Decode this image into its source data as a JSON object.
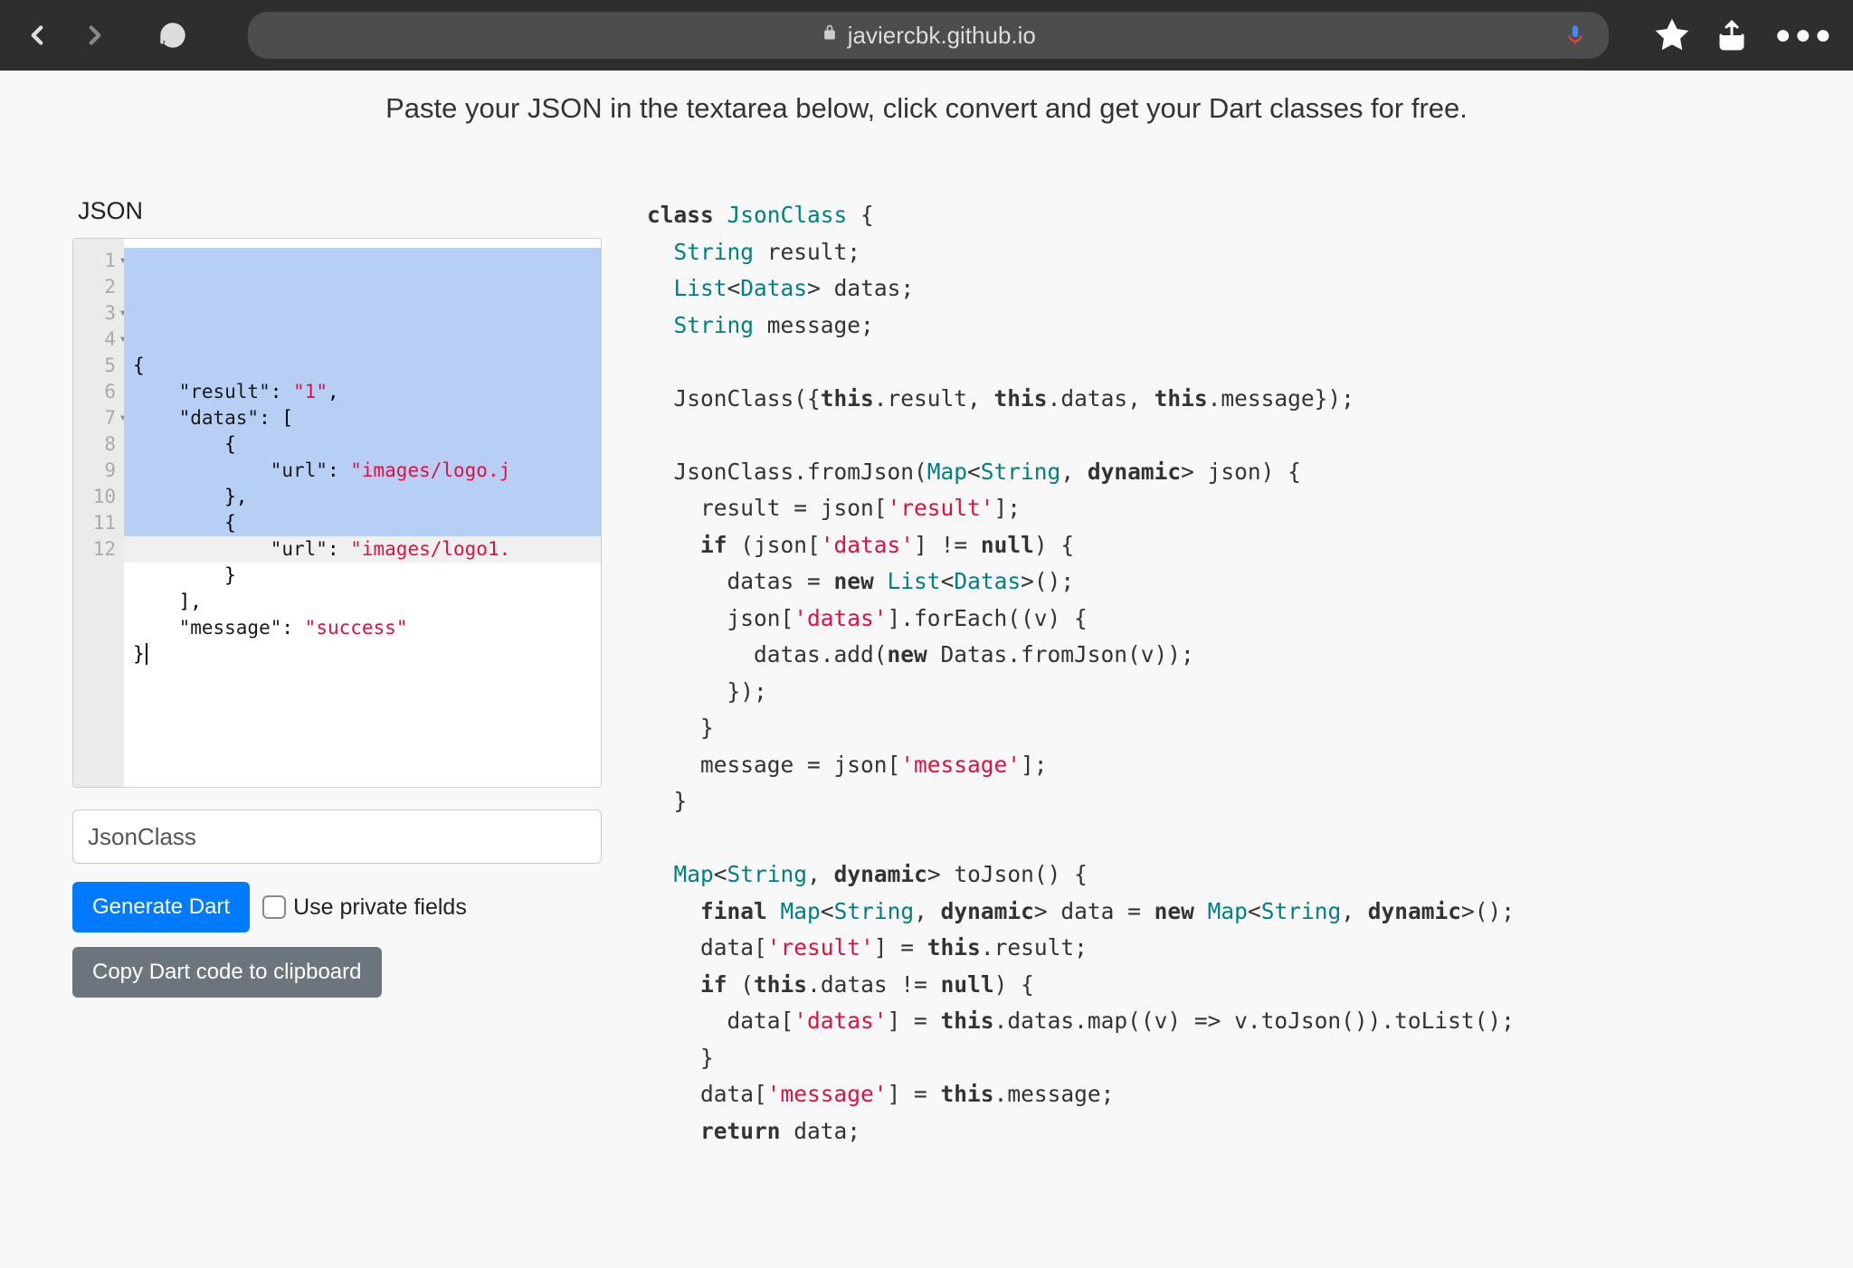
{
  "browser": {
    "url_display": "javiercbk.github.io"
  },
  "instruction": "Paste your JSON in the textarea below, click convert and get your Dart classes for free.",
  "left": {
    "section_label": "JSON",
    "line_numbers": [
      "1",
      "2",
      "3",
      "4",
      "5",
      "6",
      "7",
      "8",
      "9",
      "10",
      "11",
      "12"
    ],
    "fold_lines": [
      "1",
      "3",
      "4",
      "7"
    ],
    "json_lines_html": [
      "{",
      "    <span class='tk-key'>\"result\"</span>: <span class='tk-str'>\"1\"</span>,",
      "    <span class='tk-key'>\"datas\"</span>: [",
      "        {",
      "            <span class='tk-key'>\"url\"</span>: <span class='tk-str'>\"images/logo.j</span>",
      "        },",
      "        {",
      "            <span class='tk-key'>\"url\"</span>: <span class='tk-str'>\"images/logo1.</span>",
      "        }",
      "    ],",
      "    <span class='tk-key'>\"message\"</span>: <span class='tk-str'>\"success\"</span>",
      "}<span class='cursor-mark'></span>"
    ],
    "class_name_value": "JsonClass",
    "generate_label": "Generate Dart",
    "private_fields_label": "Use private fields",
    "copy_label": "Copy Dart code to clipboard"
  },
  "right": {
    "dart_html": "<span class='k'>class</span> <span class='type'>JsonClass</span> {\n  <span class='type'>String</span> result;\n  <span class='type'>List</span>&lt;<span class='type'>Datas</span>&gt; datas;\n  <span class='type'>String</span> message;\n\n  JsonClass({<span class='k'>this</span>.result, <span class='k'>this</span>.datas, <span class='k'>this</span>.message});\n\n  JsonClass.fromJson(<span class='type'>Map</span>&lt;<span class='type'>String</span>, <span class='k'>dynamic</span>&gt; json) {\n    result = json[<span class='str'>'result'</span>];\n    <span class='k'>if</span> (json[<span class='str'>'datas'</span>] != <span class='k'>null</span>) {\n      datas = <span class='k'>new</span> <span class='type'>List</span>&lt;<span class='type'>Datas</span>&gt;();\n      json[<span class='str'>'datas'</span>].forEach((v) {\n        datas.add(<span class='k'>new</span> Datas.fromJson(v));\n      });\n    }\n    message = json[<span class='str'>'message'</span>];\n  }\n\n  <span class='type'>Map</span>&lt;<span class='type'>String</span>, <span class='k'>dynamic</span>&gt; toJson() {\n    <span class='k'>final</span> <span class='type'>Map</span>&lt;<span class='type'>String</span>, <span class='k'>dynamic</span>&gt; data = <span class='k'>new</span> <span class='type'>Map</span>&lt;<span class='type'>String</span>, <span class='k'>dynamic</span>&gt;();\n    data[<span class='str'>'result'</span>] = <span class='k'>this</span>.result;\n    <span class='k'>if</span> (<span class='k'>this</span>.datas != <span class='k'>null</span>) {\n      data[<span class='str'>'datas'</span>] = <span class='k'>this</span>.datas.map((v) =&gt; v.toJson()).toList();\n    }\n    data[<span class='str'>'message'</span>] = <span class='k'>this</span>.message;\n    <span class='k'>return</span> data;"
  }
}
